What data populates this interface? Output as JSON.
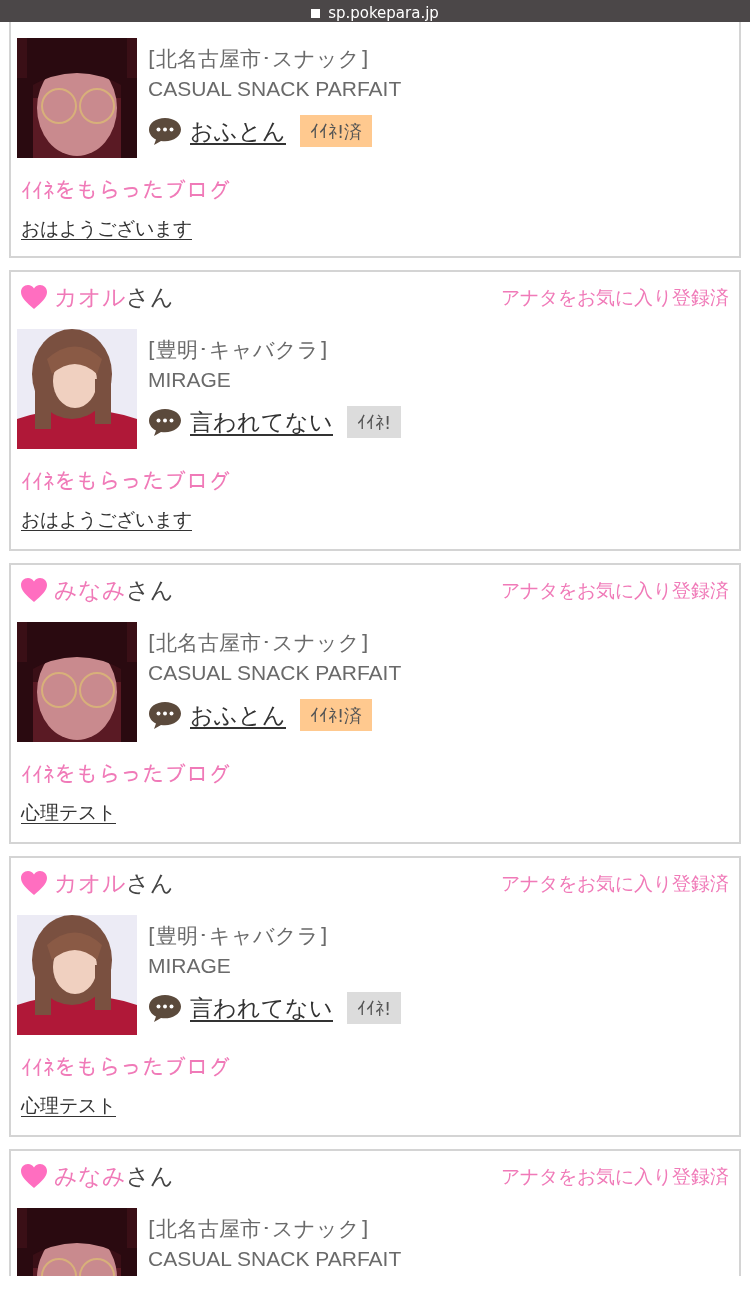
{
  "address_bar": {
    "url": "sp.pokepara.jp"
  },
  "cards": [
    {
      "area": "[北名古屋市･スナック]",
      "shop": "CASUAL SNACK PARFAIT",
      "comment": "おふとん",
      "like_label": "ｲｲﾈ!済",
      "liked": true,
      "blog_label": "ｲｲﾈをもらったブログ",
      "blog_title": "おはようございます"
    },
    {
      "name": "カオル",
      "honorific": "さん",
      "favorite_status": "アナタをお気に入り登録済",
      "area": "[豊明･キャバクラ]",
      "shop": "MIRAGE",
      "comment": "言われてない",
      "like_label": "ｲｲﾈ!",
      "liked": false,
      "blog_label": "ｲｲﾈをもらったブログ",
      "blog_title": "おはようございます"
    },
    {
      "name": "みなみ",
      "honorific": "さん",
      "favorite_status": "アナタをお気に入り登録済",
      "area": "[北名古屋市･スナック]",
      "shop": "CASUAL SNACK PARFAIT",
      "comment": "おふとん",
      "like_label": "ｲｲﾈ!済",
      "liked": true,
      "blog_label": "ｲｲﾈをもらったブログ",
      "blog_title": "心理テスト"
    },
    {
      "name": "カオル",
      "honorific": "さん",
      "favorite_status": "アナタをお気に入り登録済",
      "area": "[豊明･キャバクラ]",
      "shop": "MIRAGE",
      "comment": "言われてない",
      "like_label": "ｲｲﾈ!",
      "liked": false,
      "blog_label": "ｲｲﾈをもらったブログ",
      "blog_title": "心理テスト"
    },
    {
      "name": "みなみ",
      "honorific": "さん",
      "favorite_status": "アナタをお気に入り登録済",
      "area": "[北名古屋市･スナック]",
      "shop": "CASUAL SNACK PARFAIT"
    }
  ]
}
